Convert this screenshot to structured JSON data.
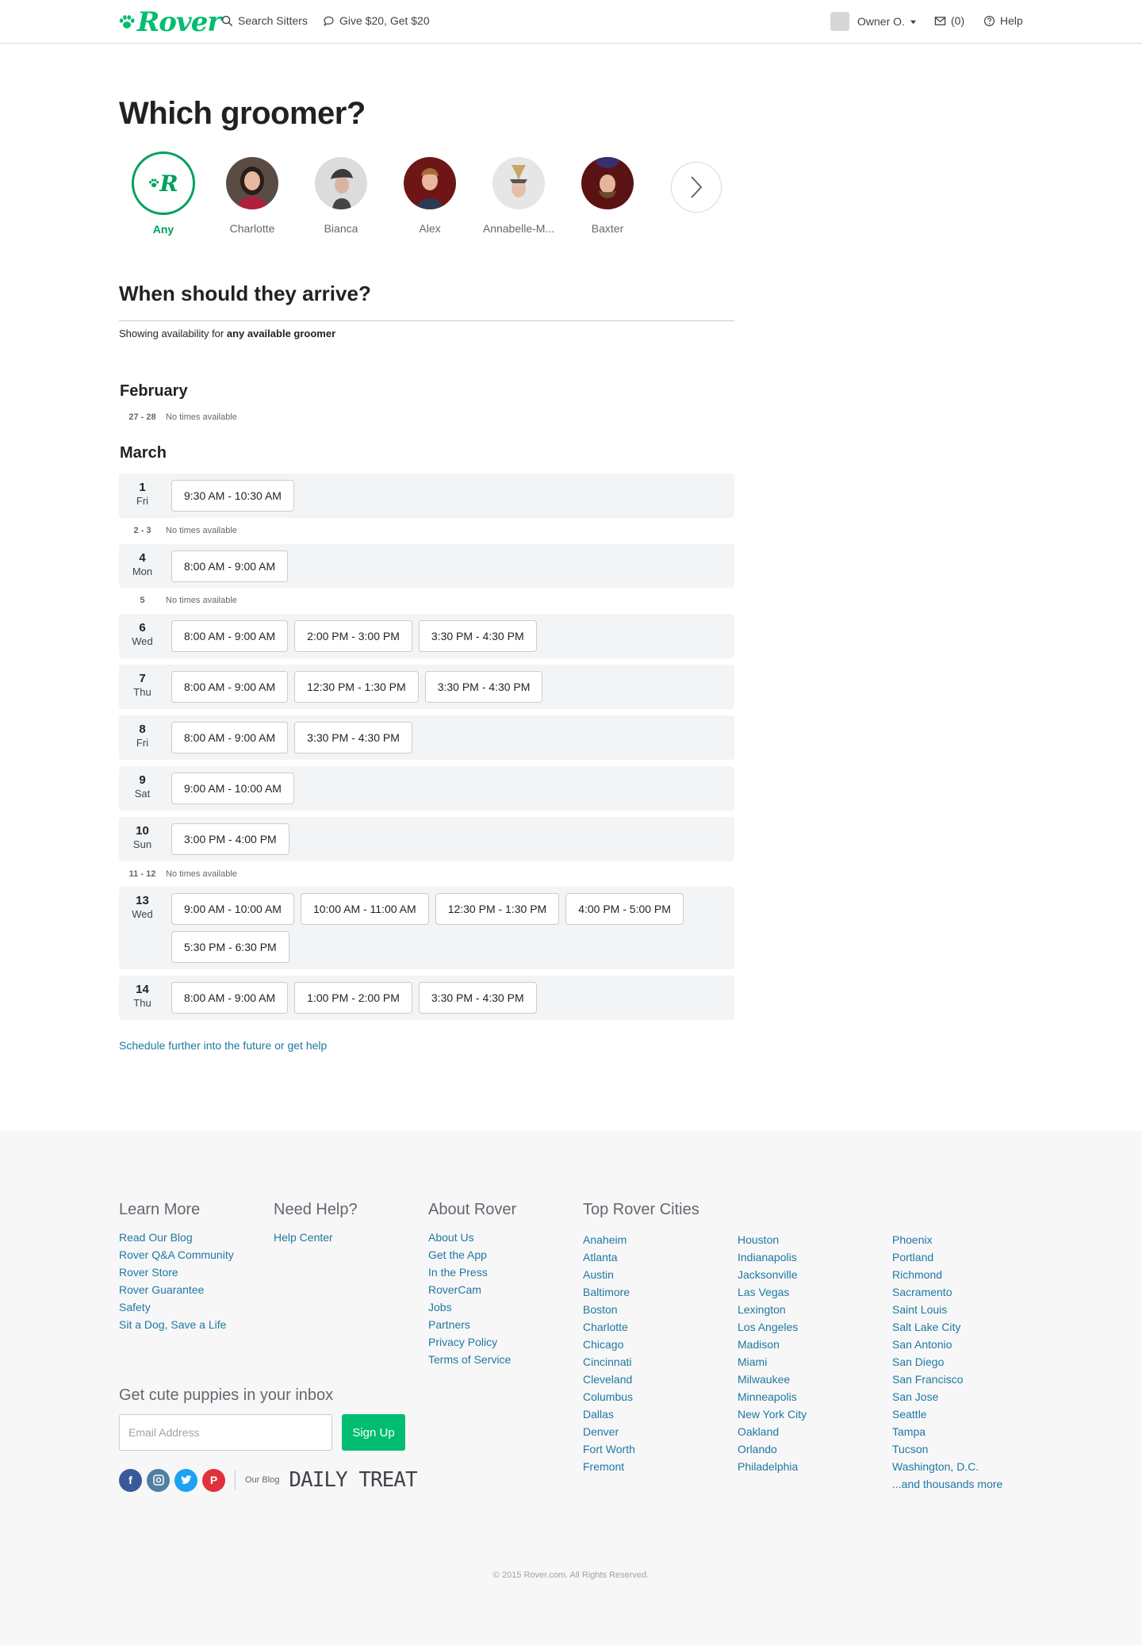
{
  "header": {
    "logo": "Rover",
    "search_sitters": "Search Sitters",
    "give_get": "Give $20, Get $20",
    "owner": "Owner O.",
    "messages": "(0)",
    "help": "Help"
  },
  "title": "Which groomer?",
  "groomers": [
    {
      "name": "Any",
      "selected": true
    },
    {
      "name": "Charlotte"
    },
    {
      "name": "Bianca"
    },
    {
      "name": "Alex"
    },
    {
      "name": "Annabelle-M..."
    },
    {
      "name": "Baxter"
    }
  ],
  "arrival": {
    "title": "When should they arrive?",
    "showing_prefix": "Showing availability for",
    "showing_bold": "any available groomer"
  },
  "months": {
    "february": "February",
    "march": "March"
  },
  "no_times": "No times available",
  "schedule": {
    "feb_nodates": "27 - 28",
    "gap_2_3": "2 - 3",
    "gap_5": "5",
    "gap_11_12": "11 - 12",
    "days": [
      {
        "num": "1",
        "wd": "Fri",
        "slots": [
          "9:30 AM - 10:30 AM"
        ]
      },
      {
        "num": "4",
        "wd": "Mon",
        "slots": [
          "8:00 AM - 9:00 AM"
        ]
      },
      {
        "num": "6",
        "wd": "Wed",
        "slots": [
          "8:00 AM - 9:00 AM",
          "2:00 PM - 3:00 PM",
          "3:30 PM - 4:30 PM"
        ]
      },
      {
        "num": "7",
        "wd": "Thu",
        "slots": [
          "8:00 AM - 9:00 AM",
          "12:30 PM - 1:30 PM",
          "3:30 PM - 4:30 PM"
        ]
      },
      {
        "num": "8",
        "wd": "Fri",
        "slots": [
          "8:00 AM - 9:00 AM",
          "3:30 PM - 4:30 PM"
        ]
      },
      {
        "num": "9",
        "wd": "Sat",
        "slots": [
          "9:00 AM - 10:00 AM"
        ]
      },
      {
        "num": "10",
        "wd": "Sun",
        "slots": [
          "3:00 PM - 4:00 PM"
        ]
      },
      {
        "num": "13",
        "wd": "Wed",
        "slots": [
          "9:00 AM - 10:00 AM",
          "10:00 AM - 11:00 AM",
          "12:30 PM - 1:30 PM",
          "4:00 PM - 5:00 PM",
          "5:30 PM - 6:30 PM"
        ]
      },
      {
        "num": "14",
        "wd": "Thu",
        "slots": [
          "8:00 AM - 9:00 AM",
          "1:00 PM - 2:00 PM",
          "3:30 PM - 4:30 PM"
        ]
      }
    ]
  },
  "further_link": "Schedule further into the future or get help",
  "footer": {
    "learn_more": {
      "title": "Learn More",
      "links": [
        "Read Our Blog",
        "Rover Q&A Community",
        "Rover Store",
        "Rover Guarantee",
        "Safety",
        "Sit a Dog, Save a Life"
      ]
    },
    "need_help": {
      "title": "Need Help?",
      "links": [
        "Help Center"
      ]
    },
    "about": {
      "title": "About Rover",
      "links": [
        "About Us",
        "Get the App",
        "In the Press",
        "RoverCam",
        "Jobs",
        "Partners",
        "Privacy Policy",
        "Terms of Service"
      ]
    },
    "cities": {
      "title": "Top Rover Cities",
      "col1": [
        "Anaheim",
        "Atlanta",
        "Austin",
        "Baltimore",
        "Boston",
        "Charlotte",
        "Chicago",
        "Cincinnati",
        "Cleveland",
        "Columbus",
        "Dallas",
        "Denver",
        "Fort Worth",
        "Fremont"
      ],
      "col2": [
        "Houston",
        "Indianapolis",
        "Jacksonville",
        "Las Vegas",
        "Lexington",
        "Los Angeles",
        "Madison",
        "Miami",
        "Milwaukee",
        "Minneapolis",
        "New York City",
        "Oakland",
        "Orlando",
        "Philadelphia"
      ],
      "col3": [
        "Phoenix",
        "Portland",
        "Richmond",
        "Sacramento",
        "Saint Louis",
        "Salt Lake City",
        "San Antonio",
        "San Diego",
        "San Francisco",
        "San Jose",
        "Seattle",
        "Tampa",
        "Tucson",
        "Washington, D.C.",
        "...and thousands more"
      ]
    },
    "newsletter": {
      "title": "Get cute puppies in your inbox",
      "placeholder": "Email Address",
      "button": "Sign Up"
    },
    "our_blog": "Our Blog",
    "daily_treat": "DAILY TREAT",
    "copyright": "© 2015 Rover.com. All Rights Reserved."
  },
  "colors": {
    "brand_green": "#00bd70",
    "link_blue": "#1e78a0",
    "facebook": "#3b5998",
    "instagram": "#517fa4",
    "twitter": "#1da1f2",
    "pinterest": "#e0323c"
  },
  "icons": {
    "search": "search-icon",
    "chat": "chat-bubble-icon",
    "dropdown": "caret-down-icon",
    "mail": "mail-icon",
    "help": "help-circle-icon",
    "next": "chevron-right-icon"
  }
}
